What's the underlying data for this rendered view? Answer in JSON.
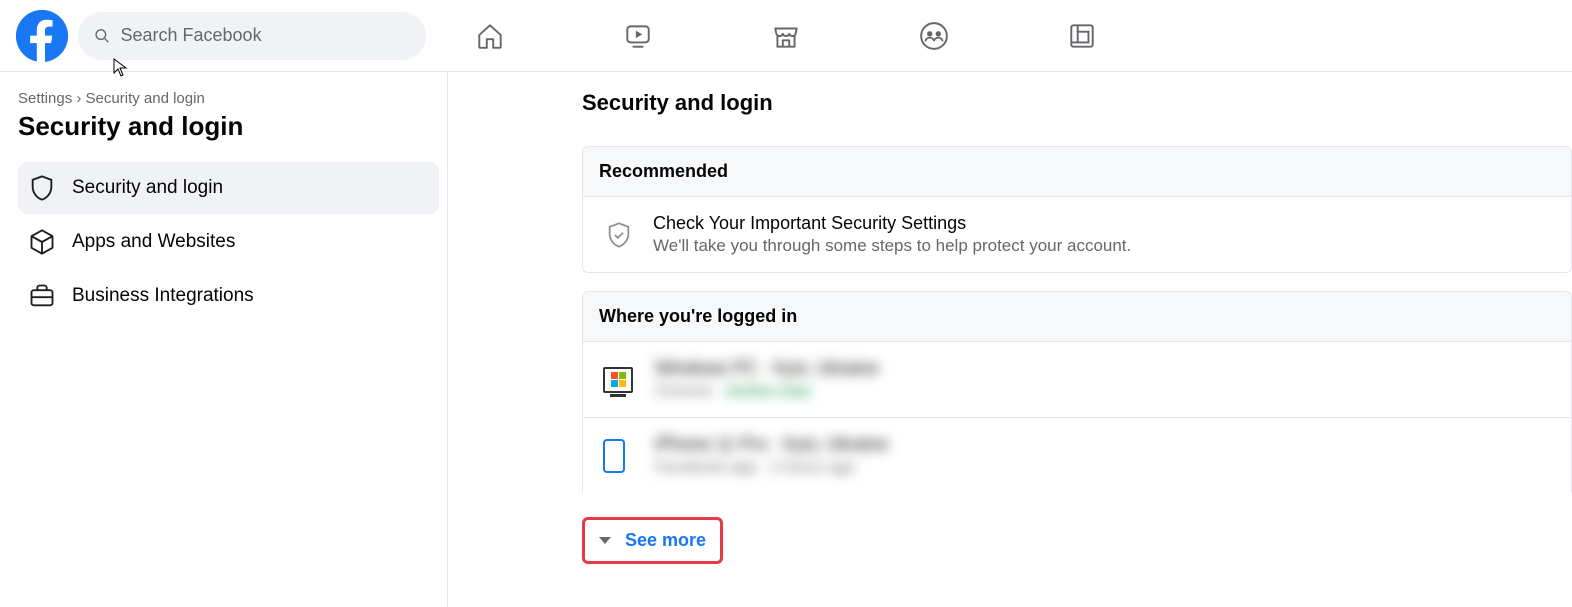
{
  "search": {
    "placeholder": "Search Facebook"
  },
  "breadcrumb": {
    "root": "Settings",
    "sep": " › ",
    "current": "Security and login"
  },
  "pageTitle": "Security and login",
  "sidebar": {
    "items": [
      {
        "label": "Security and login"
      },
      {
        "label": "Apps and Websites"
      },
      {
        "label": "Business Integrations"
      }
    ]
  },
  "main": {
    "title": "Security and login",
    "recommended": {
      "header": "Recommended",
      "row_title": "Check Your Important Security Settings",
      "row_sub": "We'll take you through some steps to help protect your account."
    },
    "sessions": {
      "header": "Where you're logged in",
      "items": [
        {
          "device_type": "windows",
          "title_blur": "Windows PC · Kyiv, Ukraine",
          "sub_blur": "Chrome · ",
          "active_blur": "Active now"
        },
        {
          "device_type": "apple",
          "title_blur": "iPhone 11 Pro · Kyiv, Ukraine",
          "sub_blur": "Facebook app · 2 hours ago",
          "active_blur": ""
        }
      ],
      "see_more": "See more"
    }
  }
}
